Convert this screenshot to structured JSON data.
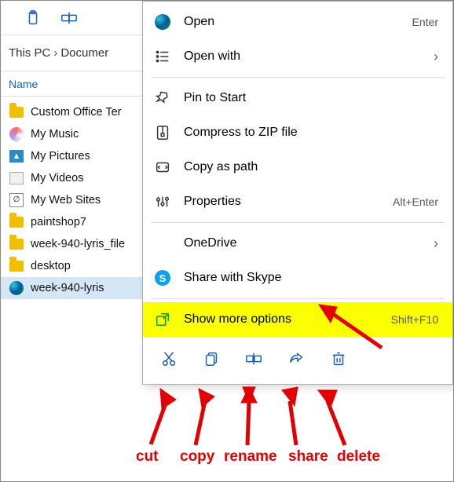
{
  "toolbar_icons": [
    "paste-icon",
    "rename-icon"
  ],
  "breadcrumb": {
    "root": "This PC",
    "folder": "Documer"
  },
  "header": {
    "name": "Name"
  },
  "files": [
    {
      "name": "Custom Office Ter",
      "icon": "folder"
    },
    {
      "name": "My Music",
      "icon": "disc"
    },
    {
      "name": "My Pictures",
      "icon": "pic"
    },
    {
      "name": "My Videos",
      "icon": "vid"
    },
    {
      "name": "My Web Sites",
      "icon": "web"
    },
    {
      "name": "paintshop7",
      "icon": "folder"
    },
    {
      "name": "week-940-lyris_file",
      "icon": "folder"
    },
    {
      "name": "desktop",
      "icon": "folder"
    },
    {
      "name": "week-940-lyris",
      "icon": "edge",
      "selected": true
    }
  ],
  "menu": [
    {
      "label": "Open",
      "icon": "edge",
      "accel": "Enter"
    },
    {
      "label": "Open with",
      "icon": "openwith",
      "sub": true
    },
    {
      "sep": true
    },
    {
      "label": "Pin to Start",
      "icon": "pin"
    },
    {
      "label": "Compress to ZIP file",
      "icon": "zip"
    },
    {
      "label": "Copy as path",
      "icon": "copypath"
    },
    {
      "label": "Properties",
      "icon": "props",
      "accel": "Alt+Enter"
    },
    {
      "sep": true
    },
    {
      "label": "OneDrive",
      "icon": "blank",
      "sub": true
    },
    {
      "label": "Share with Skype",
      "icon": "skype"
    },
    {
      "sep": true
    },
    {
      "label": "Show more options",
      "icon": "showmore",
      "accel": "Shift+F10",
      "highlight": true
    }
  ],
  "bottom_icons": [
    "cut",
    "copy",
    "rename",
    "share",
    "delete"
  ],
  "labels": {
    "cut": "cut",
    "copy": "copy",
    "rename": "rename",
    "share": "share",
    "delete": "delete"
  }
}
